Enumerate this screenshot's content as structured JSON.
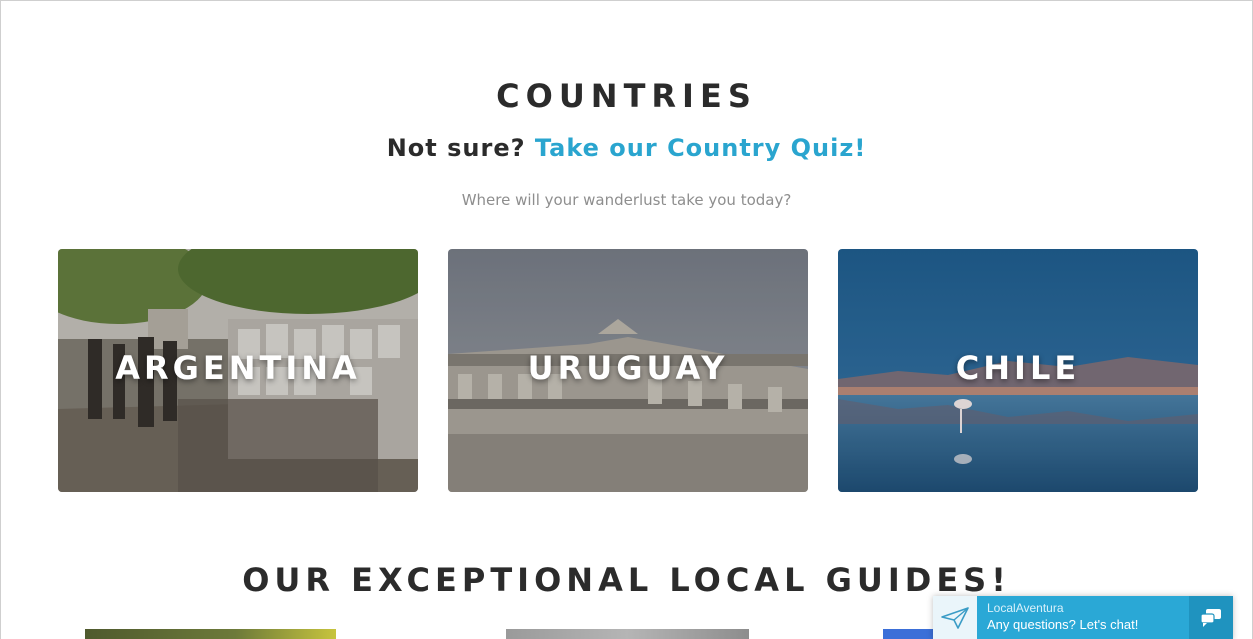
{
  "countries": {
    "title": "COUNTRIES",
    "quiz_prefix": "Not sure?",
    "quiz_link": "Take our Country Quiz!",
    "tagline": "Where will your wanderlust take you today?",
    "cards": [
      {
        "label": "ARGENTINA"
      },
      {
        "label": "URUGUAY"
      },
      {
        "label": "CHILE"
      }
    ]
  },
  "guides": {
    "title": "OUR EXCEPTIONAL LOCAL GUIDES!"
  },
  "chat": {
    "brand": "LocalAventura",
    "message": "Any questions? Let's chat!",
    "icon_left": "paper-plane-icon",
    "icon_right": "chat-bubbles-icon",
    "accent": "#2aa8d6"
  },
  "colors": {
    "heading": "#2b2b2b",
    "link": "#2aa5cf",
    "muted": "#8e8e8e"
  }
}
